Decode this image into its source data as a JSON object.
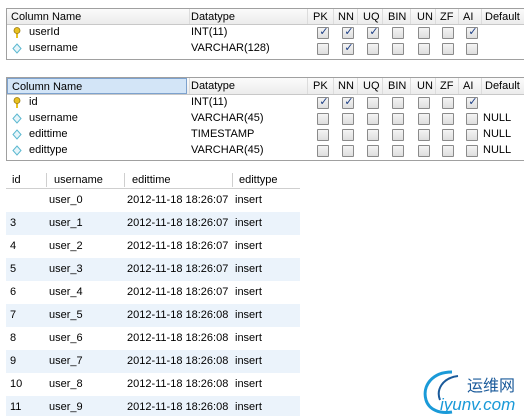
{
  "grid_headers": [
    "Column Name",
    "Datatype",
    "PK",
    "NN",
    "UQ",
    "BIN",
    "UN",
    "ZF",
    "AI",
    "Default"
  ],
  "table1": {
    "rows": [
      {
        "name": "userId",
        "icon": "key-icon",
        "type": "INT(11)",
        "flags": [
          true,
          true,
          true,
          false,
          false,
          false,
          true
        ],
        "default": ""
      },
      {
        "name": "username",
        "icon": "diamond-icon",
        "type": "VARCHAR(128)",
        "flags": [
          false,
          true,
          false,
          false,
          false,
          false,
          false
        ],
        "default": ""
      }
    ]
  },
  "table2": {
    "rows": [
      {
        "name": "id",
        "icon": "key-icon",
        "type": "INT(11)",
        "flags": [
          true,
          true,
          false,
          false,
          false,
          false,
          true
        ],
        "default": ""
      },
      {
        "name": "username",
        "icon": "diamond-icon",
        "type": "VARCHAR(45)",
        "flags": [
          false,
          false,
          false,
          false,
          false,
          false,
          false
        ],
        "default": "NULL"
      },
      {
        "name": "edittime",
        "icon": "diamond-icon",
        "type": "TIMESTAMP",
        "flags": [
          false,
          false,
          false,
          false,
          false,
          false,
          false
        ],
        "default": "NULL"
      },
      {
        "name": "edittype",
        "icon": "diamond-icon",
        "type": "VARCHAR(45)",
        "flags": [
          false,
          false,
          false,
          false,
          false,
          false,
          false
        ],
        "default": "NULL"
      }
    ]
  },
  "result": {
    "headers": [
      "id",
      "username",
      "edittime",
      "edittype"
    ],
    "rows": [
      [
        "",
        "user_0",
        "2012-11-18 18:26:07",
        "insert"
      ],
      [
        "3",
        "user_1",
        "2012-11-18 18:26:07",
        "insert"
      ],
      [
        "4",
        "user_2",
        "2012-11-18 18:26:07",
        "insert"
      ],
      [
        "5",
        "user_3",
        "2012-11-18 18:26:07",
        "insert"
      ],
      [
        "6",
        "user_4",
        "2012-11-18 18:26:07",
        "insert"
      ],
      [
        "7",
        "user_5",
        "2012-11-18 18:26:08",
        "insert"
      ],
      [
        "8",
        "user_6",
        "2012-11-18 18:26:08",
        "insert"
      ],
      [
        "9",
        "user_7",
        "2012-11-18 18:26:08",
        "insert"
      ],
      [
        "10",
        "user_8",
        "2012-11-18 18:26:08",
        "insert"
      ],
      [
        "11",
        "user_9",
        "2012-11-18 18:26:08",
        "insert"
      ]
    ]
  },
  "watermark": {
    "cn": "运维网",
    "en": "iyunv.com"
  },
  "colors": {
    "key": "#e8c020",
    "diamond": "#5bb8d0",
    "alt_row": "#ebf3fb",
    "check": "#1c3e84"
  }
}
